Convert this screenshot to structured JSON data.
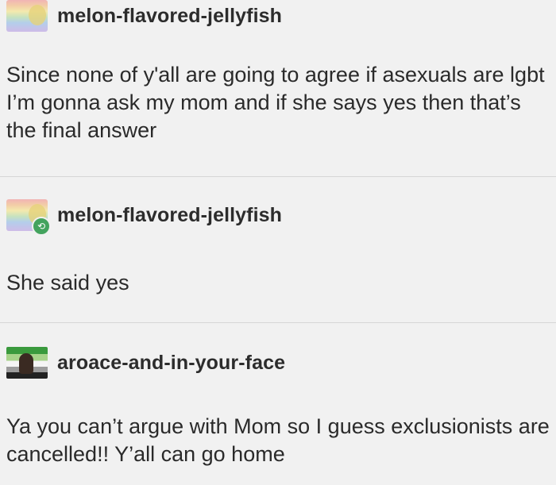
{
  "posts": [
    {
      "username": "melon-flavored-jellyfish",
      "avatar": "rainbow-avatar",
      "text": "Since none of y'all are going to agree if asexuals are lgbt I’m gonna ask my mom and if she says yes then that’s the final answer"
    },
    {
      "username": "melon-flavored-jellyfish",
      "avatar": "rainbow-avatar",
      "reblog_icon": "reblog-icon",
      "text": "She said yes"
    },
    {
      "username": "aroace-and-in-your-face",
      "avatar": "aroace-flag-avatar",
      "text": "Ya you can’t argue with Mom so I guess exclusionists are cancelled!! Y’all can go home"
    }
  ],
  "colors": {
    "background": "#f1f1f1",
    "divider": "#d6d6d6",
    "reblog_badge": "#43a35e",
    "text": "#2a2a2a"
  }
}
